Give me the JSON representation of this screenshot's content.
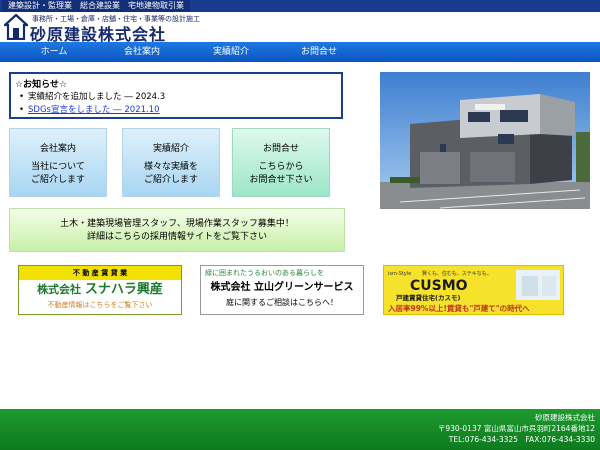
{
  "topbar": {
    "tagline": "建築設計・監理業　総合建設業　宅地建物取引業"
  },
  "header": {
    "subline": "事務所・工場・倉庫・店舗・住宅・事業等の設計施工",
    "company": "砂原建設株式会社"
  },
  "nav": [
    {
      "label": "ホーム"
    },
    {
      "label": "会社案内"
    },
    {
      "label": "実績紹介"
    },
    {
      "label": "お問合せ"
    }
  ],
  "notice": {
    "title": "☆お知らせ☆",
    "items": [
      {
        "text": "実績紹介を追加しました ― 2024.3"
      },
      {
        "text": "SDGs宣言をしました ― 2021.10"
      }
    ]
  },
  "cards": [
    {
      "title": "会社案内",
      "line1": "当社について",
      "line2": "ご紹介します"
    },
    {
      "title": "実績紹介",
      "line1": "様々な実績を",
      "line2": "ご紹介します"
    },
    {
      "title": "お問合せ",
      "line1": "こちらから",
      "line2": "お問合せ下さい"
    }
  ],
  "recruit": {
    "line1": "土木・建築現場管理スタッフ、現場作業スタッフ募集中！",
    "line2": "詳細はこちらの採用情報サイトをご覧下さい"
  },
  "banners": {
    "b1": {
      "top": "不 動 産 賃 貸 業",
      "prefix": "株式会社",
      "name": "スナハラ興産",
      "bottom": "不動産情報はこちらをご覧下さい"
    },
    "b2": {
      "top": "緑に囲まれたうるおいのある暮らしを",
      "name": "株式会社 立山グリーンサービス",
      "bottom": "庭に関するご相談はこちらへ！"
    },
    "b3": {
      "brand_small": "ism-Style",
      "tagline": "賢くも、住むも、ステキなも。",
      "brand": "CUSMO",
      "product": "戸建賃貸住宅(カスモ)",
      "catch": "入居率99%以上!賃貸も\"戸建て\"の時代へ"
    }
  },
  "footer": {
    "company": "砂原建設株式会社",
    "address": "〒930-0137 富山県富山市呉羽町2164番地12",
    "contact": "TEL:076-434-3325　FAX:076-434-3330"
  },
  "colors": {
    "nav": "#0a56bf",
    "header_text": "#152a70",
    "footer": "#0e7a1e",
    "notice_border": "#19408a"
  }
}
